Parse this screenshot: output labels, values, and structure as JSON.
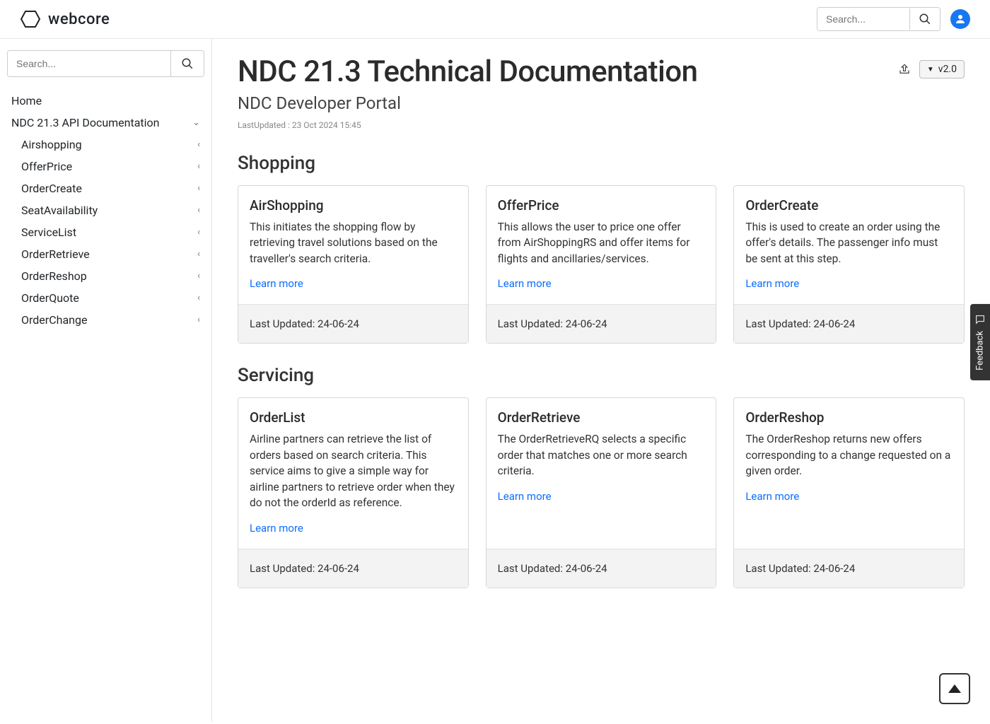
{
  "brand": {
    "name": "webcore"
  },
  "topSearch": {
    "placeholder": "Search..."
  },
  "sideSearch": {
    "placeholder": "Search..."
  },
  "version": {
    "label": "v2.0"
  },
  "nav": {
    "home": "Home",
    "root": "NDC 21.3 API Documentation",
    "items": [
      "Airshopping",
      "OfferPrice",
      "OrderCreate",
      "SeatAvailability",
      "ServiceList",
      "OrderRetrieve",
      "OrderReshop",
      "OrderQuote",
      "OrderChange"
    ]
  },
  "page": {
    "title": "NDC 21.3 Technical Documentation",
    "subtitle": "NDC Developer Portal",
    "lastUpdated": "LastUpdated : 23 Oct 2024 15:45"
  },
  "sections": {
    "shopping": {
      "title": "Shopping",
      "cards": [
        {
          "title": "AirShopping",
          "desc": "This initiates the shopping flow by retrieving travel solutions based on the traveller's search criteria.",
          "learn": "Learn more",
          "footer": "Last Updated: 24-06-24"
        },
        {
          "title": "OfferPrice",
          "desc": "This allows the user to price one offer from AirShoppingRS and offer items for flights and ancillaries/services.",
          "learn": "Learn more",
          "footer": "Last Updated: 24-06-24"
        },
        {
          "title": "OrderCreate",
          "desc": "This is used to create an order using the offer's details. The passenger info must be sent at this step.",
          "learn": "Learn more",
          "footer": "Last Updated: 24-06-24"
        }
      ]
    },
    "servicing": {
      "title": "Servicing",
      "cards": [
        {
          "title": "OrderList",
          "desc": "Airline partners can retrieve the list of orders based on search criteria. This service aims to give a simple way for airline partners to retrieve order when they do not the orderId as reference.",
          "learn": "Learn more",
          "footer": "Last Updated: 24-06-24"
        },
        {
          "title": "OrderRetrieve",
          "desc": "The OrderRetrieveRQ selects a specific order that matches one or more search criteria.",
          "learn": "Learn more",
          "footer": "Last Updated: 24-06-24"
        },
        {
          "title": "OrderReshop",
          "desc": "The OrderReshop returns new offers corresponding to a change requested on a given order.",
          "learn": "Learn more",
          "footer": "Last Updated: 24-06-24"
        }
      ]
    }
  },
  "feedback": {
    "label": "Feedback"
  }
}
